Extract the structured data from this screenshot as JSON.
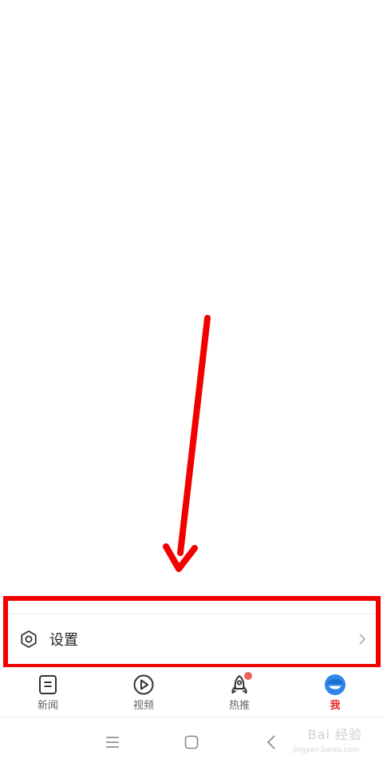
{
  "settings": {
    "label": "设置",
    "icon": "gear-icon",
    "chevron": "chevron-right-icon"
  },
  "tabs": [
    {
      "label": "新闻",
      "icon": "news-icon",
      "active": false
    },
    {
      "label": "视频",
      "icon": "play-icon",
      "active": false
    },
    {
      "label": "热推",
      "icon": "rocket-icon",
      "active": false,
      "badge": true
    },
    {
      "label": "我",
      "icon": "profile-icon",
      "active": true
    }
  ],
  "system_nav": {
    "menu": "menu-icon",
    "home": "home-icon",
    "back": "back-icon"
  },
  "watermark": {
    "text": "Bai 经验",
    "sub": "jingyan.baidu.com"
  },
  "colors": {
    "annotation": "#f20000",
    "active_tab": "#e8252b",
    "profile_blue": "#2f86e8",
    "badge": "#f06060"
  }
}
